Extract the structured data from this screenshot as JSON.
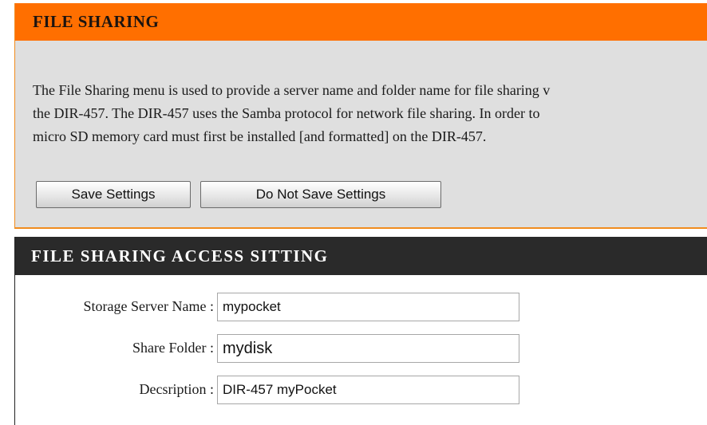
{
  "file_sharing": {
    "title": "FILE SHARING",
    "description_lines": [
      "The File Sharing menu is used to provide a server name and folder name for file sharing v",
      "the DIR-457. The DIR-457 uses the Samba protocol for network file sharing. In order to",
      "micro SD memory card must first be installed [and formatted] on the DIR-457."
    ],
    "save_label": "Save Settings",
    "no_save_label": "Do Not Save Settings"
  },
  "access": {
    "title": "FILE SHARING ACCESS SITTING",
    "fields": [
      {
        "label": "Storage Server Name :",
        "value": "mypocket"
      },
      {
        "label": "Share Folder :",
        "value": "mydisk"
      },
      {
        "label": "Decsription :",
        "value": "DIR-457 myPocket"
      }
    ]
  },
  "colors": {
    "header_orange": "#ff6f00",
    "panel_gray": "#dfdfdf",
    "header_dark": "#2a2a2a"
  }
}
